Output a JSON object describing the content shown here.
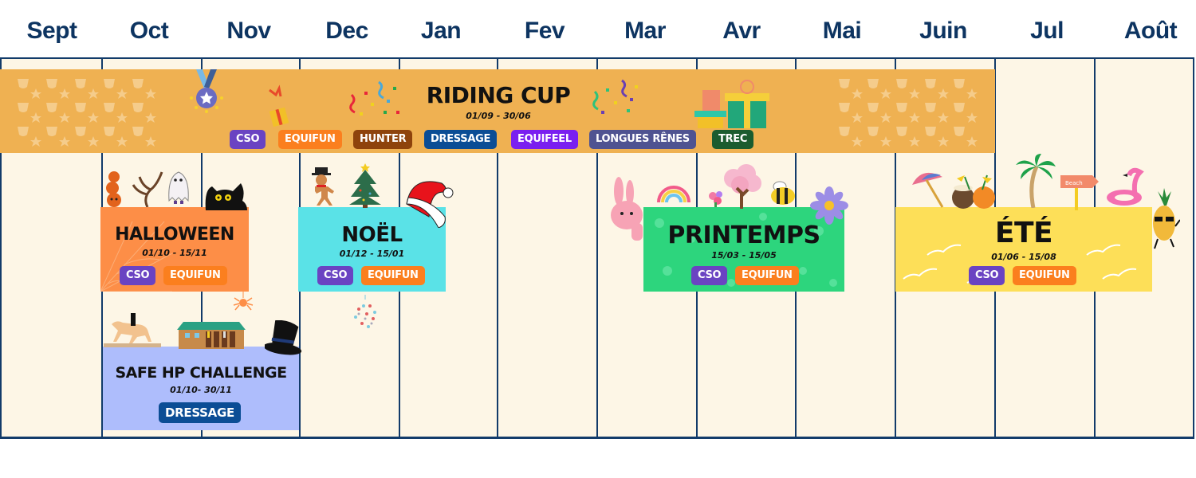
{
  "months": [
    "Sept",
    "Oct",
    "Nov",
    "Dec",
    "Jan",
    "Fev",
    "Mar",
    "Avr",
    "Mai",
    "Juin",
    "Jul",
    "Août"
  ],
  "colors": {
    "month_text": "#0d3461",
    "grid_bg": "#fdf6e6",
    "grid_line": "#123b6a",
    "tag_cso": "#6a43c2",
    "tag_equifun": "#fb7f1e",
    "tag_hunter": "#8e430c",
    "tag_dressage": "#0b4d95",
    "tag_equifeel": "#7a1ff0",
    "tag_longues_renes": "#4f5391",
    "tag_trec": "#1b5c2f"
  },
  "riding_cup": {
    "title": "RIDING CUP",
    "dates": "01/09 - 30/06",
    "tags": [
      "CSO",
      "EQUIFUN",
      "HUNTER",
      "DRESSAGE",
      "EQUIFEEL",
      "LONGUES RÊNES",
      "TREC"
    ],
    "icons": [
      "trophy-pattern-icon",
      "medal-icon",
      "gift-icon",
      "confetti-icon",
      "confetti-icon",
      "gift-boxes-icon",
      "trophy-pattern-icon"
    ]
  },
  "events": {
    "halloween": {
      "title": "HALLOWEEN",
      "dates": "01/10 - 15/11",
      "tags": [
        "CSO",
        "EQUIFUN"
      ],
      "icons": [
        "pumpkins-icon",
        "spooky-tree-icon",
        "ghost-icon",
        "black-cat-icon",
        "spider-icon"
      ]
    },
    "noel": {
      "title": "NOËL",
      "dates": "01/12 - 15/01",
      "tags": [
        "CSO",
        "EQUIFUN"
      ],
      "icons": [
        "gingerbread-man-icon",
        "christmas-tree-icon",
        "santa-hat-icon",
        "ornament-ball-icon"
      ]
    },
    "printemps": {
      "title": "PRINTEMPS",
      "dates": "15/03 - 15/05",
      "tags": [
        "CSO",
        "EQUIFUN"
      ],
      "icons": [
        "bunny-icon",
        "rainbow-icon",
        "flowers-icon",
        "cherry-blossom-tree-icon",
        "bee-icon",
        "daisy-icon"
      ]
    },
    "ete": {
      "title": "ÉTÉ",
      "dates": "01/06 - 15/08",
      "tags": [
        "CSO",
        "EQUIFUN"
      ],
      "icons": [
        "beach-umbrella-icon",
        "coconut-drinks-icon",
        "palm-tree-icon",
        "beach-sign-icon",
        "flamingo-float-icon",
        "pineapple-icon"
      ],
      "beach_sign_text": "Beach"
    },
    "safe_hp": {
      "title": "SAFE HP CHALLENGE",
      "dates": "01/10- 30/11",
      "tags": [
        "DRESSAGE"
      ],
      "icons": [
        "dressage-rider-icon",
        "stable-icon",
        "top-hat-icon"
      ]
    }
  }
}
